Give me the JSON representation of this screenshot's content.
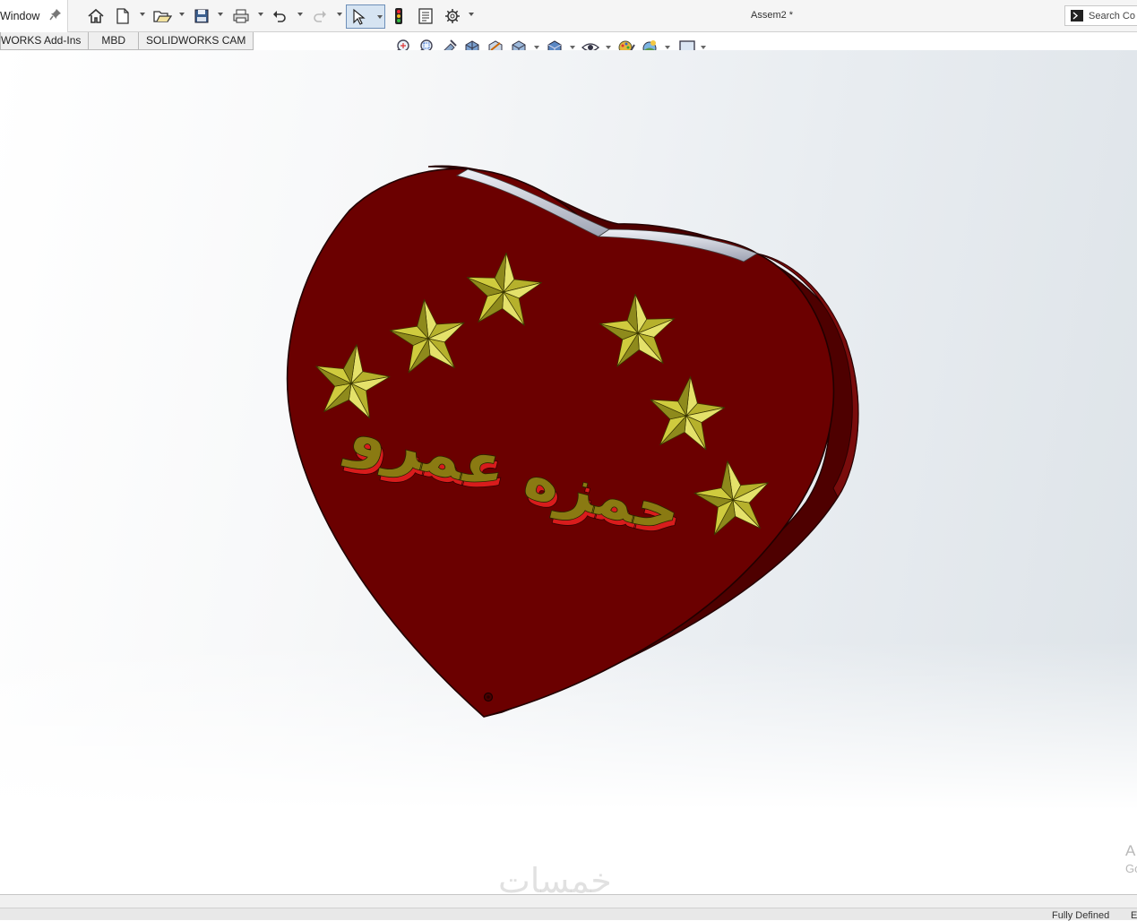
{
  "menu": {
    "window_label": "Window"
  },
  "document": {
    "title": "Assem2 *"
  },
  "search": {
    "label": "Search Co"
  },
  "tabs": [
    {
      "label": "WORKS Add-Ins"
    },
    {
      "label": "MBD"
    },
    {
      "label": "SOLIDWORKS CAM"
    }
  ],
  "model": {
    "engraved_text": "حمزه عمرو",
    "stars": 6,
    "colors": {
      "body": "#6b0000",
      "side": "#5a0000",
      "edge": "#2a0000",
      "slot": "#c9ccd6",
      "star_light": "#e4e16a",
      "star_dark": "#8e8a1c",
      "text_face": "#8a7a12",
      "text_shadow": "#d81c1c"
    }
  },
  "activation": {
    "line1": "A",
    "line2": "Go"
  },
  "watermark": "خمسات",
  "status": {
    "state": "Fully Defined",
    "extra": "E"
  }
}
